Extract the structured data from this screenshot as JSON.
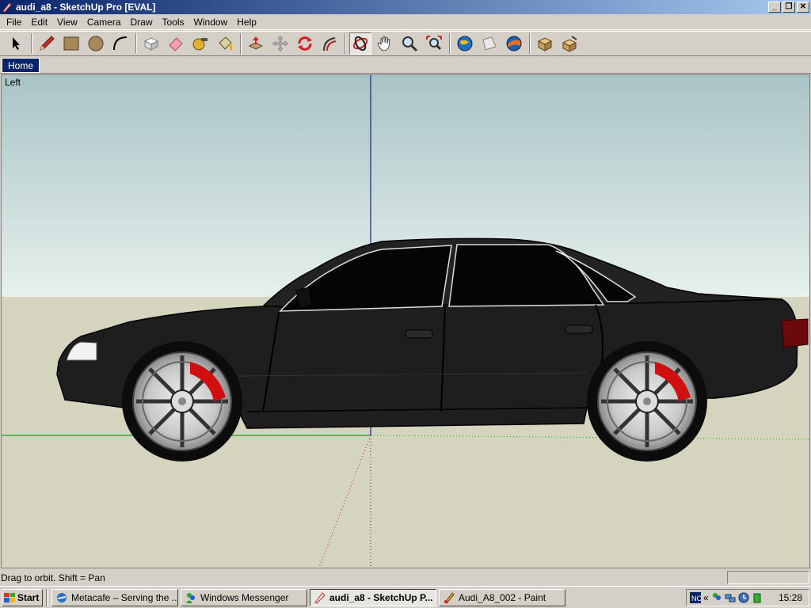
{
  "window": {
    "title": "audi_a8 - SketchUp Pro [EVAL]"
  },
  "menu": [
    "File",
    "Edit",
    "View",
    "Camera",
    "Draw",
    "Tools",
    "Window",
    "Help"
  ],
  "toolbar": {
    "tools": [
      {
        "name": "select-tool",
        "icon": "arrow-icon"
      },
      {
        "name": "pencil-tool",
        "icon": "pencil-icon"
      },
      {
        "name": "rectangle-tool",
        "icon": "rectangle-icon"
      },
      {
        "name": "circle-tool",
        "icon": "circle-icon"
      },
      {
        "name": "arc-tool",
        "icon": "arc-icon"
      },
      {
        "name": "make-component-tool",
        "icon": "component-icon"
      },
      {
        "name": "eraser-tool",
        "icon": "eraser-icon"
      },
      {
        "name": "tape-measure-tool",
        "icon": "tape-icon"
      },
      {
        "name": "paint-bucket-tool",
        "icon": "bucket-icon"
      },
      {
        "name": "push-pull-tool",
        "icon": "pushpull-icon"
      },
      {
        "name": "move-tool",
        "icon": "move-icon"
      },
      {
        "name": "rotate-tool",
        "icon": "rotate-icon"
      },
      {
        "name": "follow-me-tool",
        "icon": "followme-icon"
      },
      {
        "name": "orbit-tool",
        "icon": "orbit-icon"
      },
      {
        "name": "pan-tool",
        "icon": "hand-icon"
      },
      {
        "name": "zoom-tool",
        "icon": "magnifier-icon"
      },
      {
        "name": "zoom-extents-tool",
        "icon": "zoom-extents-icon"
      },
      {
        "name": "get-models-tool",
        "icon": "globe-icon"
      },
      {
        "name": "share-model-tool",
        "icon": "share-icon"
      },
      {
        "name": "google-earth-tool",
        "icon": "earth-icon"
      },
      {
        "name": "component-window-tool",
        "icon": "box-icon"
      },
      {
        "name": "extension-tool",
        "icon": "box-gear-icon"
      }
    ],
    "active_tool": "orbit-tool"
  },
  "scenes": {
    "tab": "Home"
  },
  "viewport": {
    "view_label": "Left"
  },
  "status": {
    "text": "Drag to orbit.  Shift = Pan"
  },
  "taskbar": {
    "start": "Start",
    "tasks": [
      {
        "label": "Metacafe – Serving the ...",
        "active": false,
        "icon": "ie-icon"
      },
      {
        "label": "Windows Messenger",
        "active": false,
        "icon": "messenger-icon"
      },
      {
        "label": "audi_a8 - SketchUp P...",
        "active": true,
        "icon": "sketchup-icon"
      },
      {
        "label": "Audi_A8_002 - Paint",
        "active": false,
        "icon": "paint-icon"
      }
    ],
    "clock": "15:28"
  },
  "colors": {
    "sky_top": "#a9c4c6",
    "sky_bottom": "#e6f0ec",
    "ground": "#d5d4be",
    "car_body": "#1e1e1e",
    "brake": "#d01010"
  }
}
